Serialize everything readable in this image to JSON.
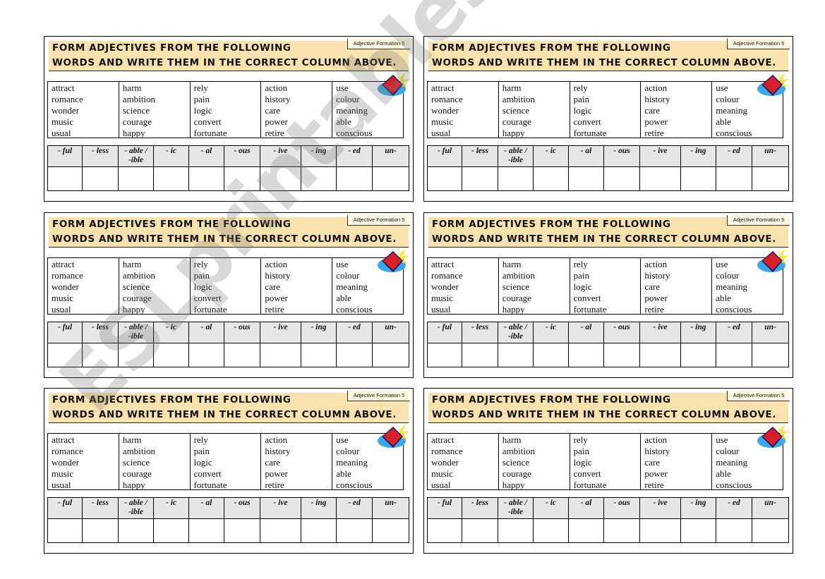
{
  "worksheet": {
    "instruction_line1": "FORM ADJECTIVES FROM THE FOLLOWING",
    "instruction_line2": "WORDS AND WRITE THEM IN THE CORRECT COLUMN ABOVE.",
    "tag": "Adjective Formation 5",
    "icon": "book-icon",
    "word_columns": [
      [
        "attract",
        "romance",
        "wonder",
        "music",
        "usual"
      ],
      [
        "harm",
        "ambition",
        "science",
        "courage",
        "happy"
      ],
      [
        "rely",
        "pain",
        "logic",
        "convert",
        "fortunate"
      ],
      [
        "action",
        "history",
        "care",
        "power",
        "retire"
      ],
      [
        "use",
        "colour",
        "meaning",
        "able",
        "conscious"
      ]
    ],
    "suffixes": [
      "- ful",
      "- less",
      "- able / -ible",
      "- ic",
      "- al",
      "- ous",
      "- ive",
      "- ing",
      "- ed",
      "un-"
    ],
    "card_count": 6
  },
  "watermark": "ESLprintables.com",
  "colors": {
    "header_band": "#f8e3ae",
    "suffix_header": "#e6e6e6",
    "book_red": "#d8202a",
    "book_glow": "#f5e84a",
    "book_splash": "#3aa8e8"
  }
}
